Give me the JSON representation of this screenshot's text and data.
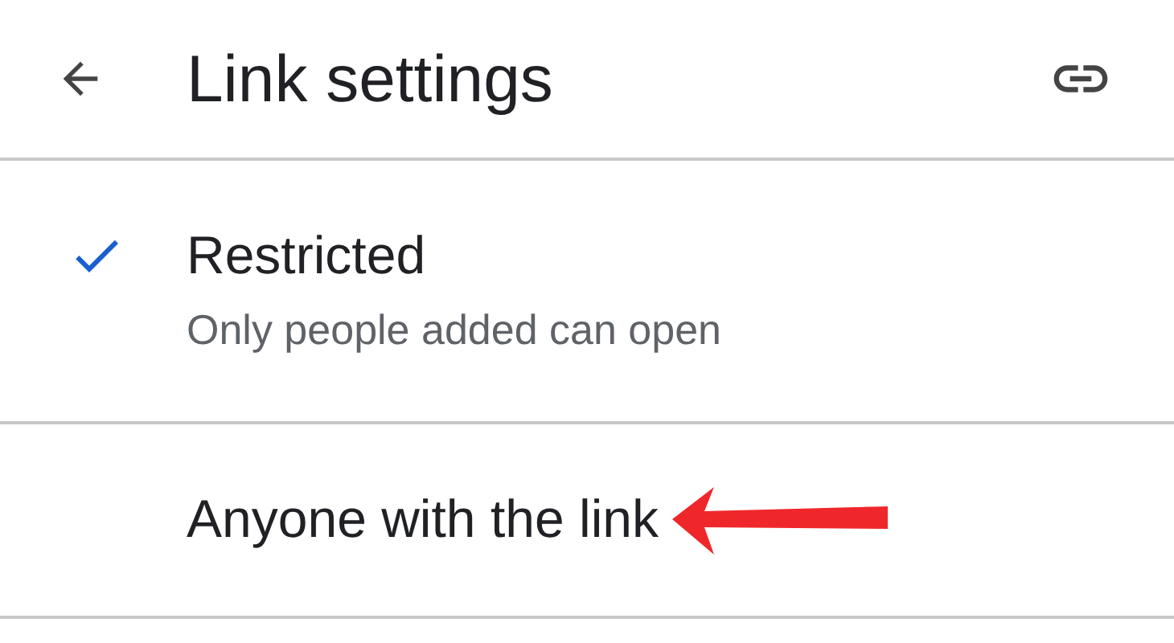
{
  "header": {
    "title": "Link settings"
  },
  "options": [
    {
      "label": "Restricted",
      "description": "Only people added can open",
      "selected": true,
      "pointed_at": false
    },
    {
      "label": "Anyone with the link",
      "selected": false,
      "pointed_at": true
    }
  ]
}
